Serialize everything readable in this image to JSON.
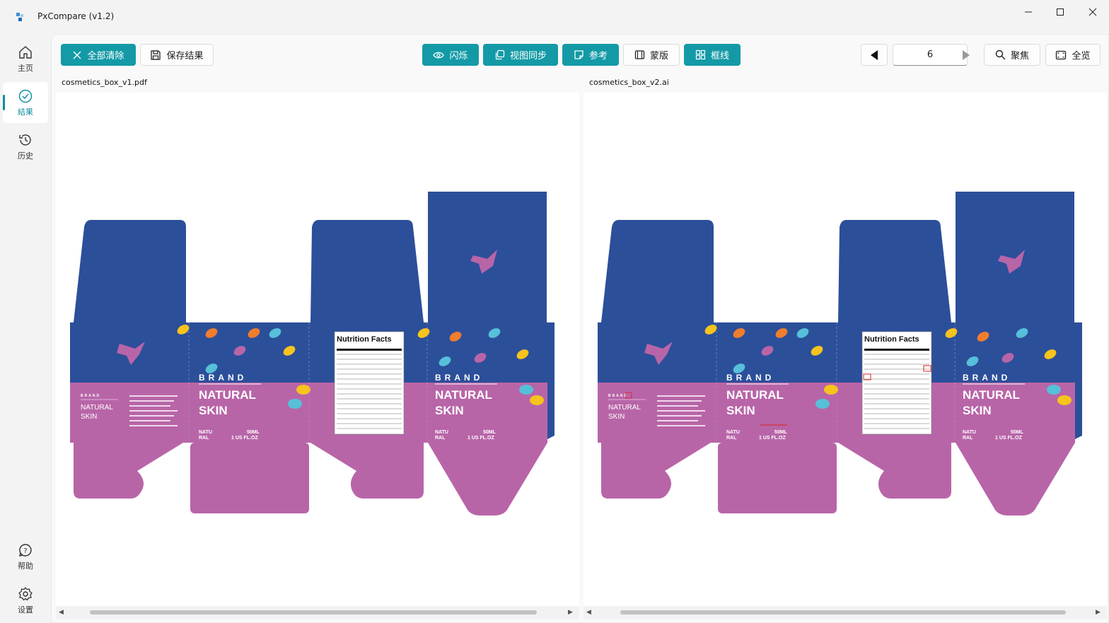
{
  "window": {
    "title": "PxCompare (v1.2)"
  },
  "sidebar": {
    "items": [
      {
        "label": "主页",
        "icon": "home-icon"
      },
      {
        "label": "結果",
        "icon": "check-circle-icon"
      },
      {
        "label": "历史",
        "icon": "history-icon"
      },
      {
        "label": "帮助",
        "icon": "help-icon"
      },
      {
        "label": "设置",
        "icon": "gear-icon"
      }
    ]
  },
  "toolbar": {
    "clear_all": "全部清除",
    "save_results": "保存结果",
    "flash": "闪烁",
    "sync_view": "视图同步",
    "reference": "参考",
    "mask": "蒙版",
    "frame_line": "框线",
    "page_number": "6",
    "focus": "聚焦",
    "overview": "全览"
  },
  "left_pane": {
    "filename": "cosmetics_box_v1.pdf"
  },
  "right_pane": {
    "filename": "cosmetics_box_v2.ai"
  },
  "artwork": {
    "brand": "BRAND",
    "product_line1": "NATURAL",
    "product_line2": "SKIN",
    "side_brand": "BRAND",
    "side_line1": "NATURAL",
    "side_line2": "SKIN",
    "small_line1": "NATU",
    "small_line2": "RAL",
    "volume": "50ML",
    "volume2": "1 US FL.OZ",
    "nutrition_title": "Nutrition Facts",
    "colors": {
      "blue": "#2c4f9a",
      "purple": "#b865a8",
      "diff_mark": "#e02020"
    }
  }
}
